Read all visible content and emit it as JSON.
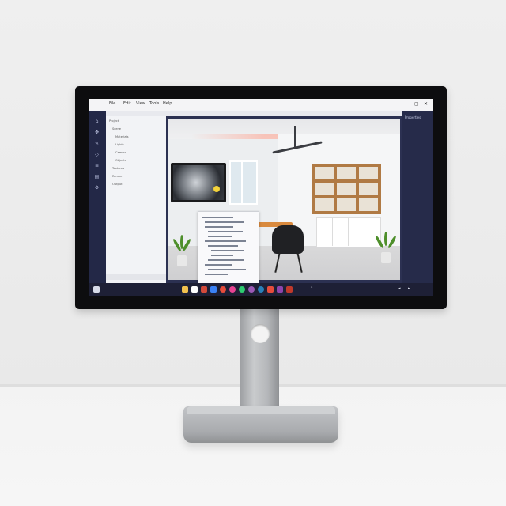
{
  "scene": {
    "description_colors": {
      "wall": "#efefef",
      "desk": "#f3f3f3",
      "bezel": "#0d0d0f",
      "stand": "#b5b7ba",
      "ui_dark": "#2c3152",
      "ui_light": "#f4f4f6"
    }
  },
  "window": {
    "menu": [
      "File",
      "Edit",
      "View",
      "Tools",
      "Help"
    ],
    "controls": [
      "—",
      "▢",
      "✕"
    ]
  },
  "sidebar": {
    "tools": [
      "select-icon",
      "move-icon",
      "brush-icon",
      "shape-icon",
      "text-icon",
      "layers-icon",
      "settings-icon"
    ]
  },
  "project_tree": {
    "rows": [
      "Project",
      "Scene",
      "Materials",
      "Lights",
      "Camera",
      "Objects",
      "Textures",
      "Render",
      "Output"
    ]
  },
  "right_panel": {
    "labels": [
      "Properties"
    ]
  },
  "taskbar": {
    "apps": [
      "#f2c14e",
      "#ffffff",
      "#d34a3b",
      "#3b82f6",
      "#e74c3c",
      "#e84393",
      "#2ecc71",
      "#9b59b6",
      "#2980b9",
      "#e74c3c",
      "#8e44ad",
      "#c0392b"
    ],
    "tray": [
      "⌃",
      "◂",
      "▸"
    ]
  }
}
